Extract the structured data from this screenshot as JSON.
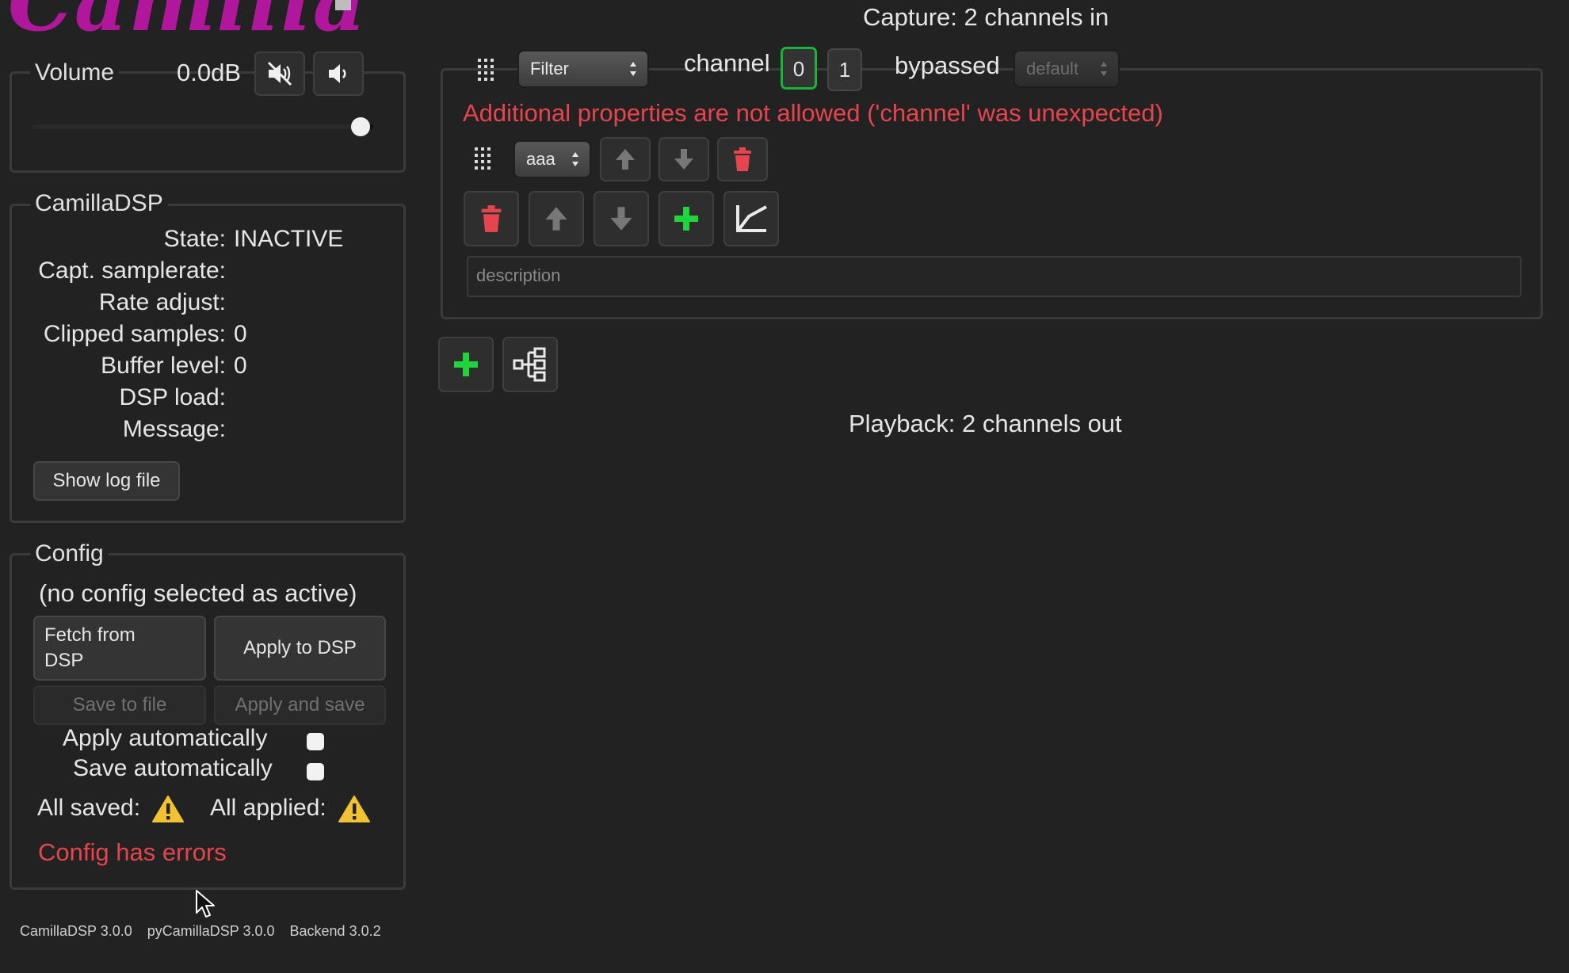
{
  "app": {
    "logo_text": "Camilla"
  },
  "colors": {
    "accent": "#b0179c",
    "error": "#e6454e",
    "add": "#1fd43c",
    "active_border": "#19b33a",
    "warning": "#f3c233"
  },
  "volume": {
    "legend": "Volume",
    "value": "0.0dB",
    "mute_icon": "speaker-mute-icon",
    "speaker_icon": "speaker-icon",
    "level": 1.0
  },
  "camilladsp": {
    "legend": "CamillaDSP",
    "rows": [
      {
        "label": "State:",
        "value": "INACTIVE"
      },
      {
        "label": "Capt. samplerate:",
        "value": ""
      },
      {
        "label": "Rate adjust:",
        "value": ""
      },
      {
        "label": "Clipped samples:",
        "value": "0"
      },
      {
        "label": "Buffer level:",
        "value": "0"
      },
      {
        "label": "DSP load:",
        "value": ""
      },
      {
        "label": "Message:",
        "value": ""
      }
    ],
    "show_log_label": "Show log file"
  },
  "config": {
    "legend": "Config",
    "active_text": "(no config selected as active)",
    "fetch_label_1": "Fetch from",
    "fetch_label_2": "DSP",
    "apply_label": "Apply to DSP",
    "save_label": "Save to file",
    "apply_save_label": "Apply and save",
    "auto_apply_label": "Apply automatically",
    "auto_save_label": "Save automatically",
    "all_saved_label": "All saved:",
    "all_applied_label": "All applied:",
    "error_text": "Config has errors"
  },
  "pipeline": {
    "capture_text": "Capture: 2 channels in",
    "playback_text": "Playback: 2 channels out",
    "step": {
      "type_select": "Filter",
      "channel_label": "channel",
      "channels": [
        "0",
        "1"
      ],
      "bypassed_label": "bypassed",
      "bypassed_select": "default",
      "error": "Additional properties are not allowed ('channel' was unexpected)",
      "filter_select": "aaa",
      "description_placeholder": "description"
    }
  },
  "footer": {
    "camilladsp": "CamillaDSP 3.0.0",
    "pycamilladsp": "pyCamillaDSP 3.0.0",
    "backend": "Backend 3.0.2"
  }
}
